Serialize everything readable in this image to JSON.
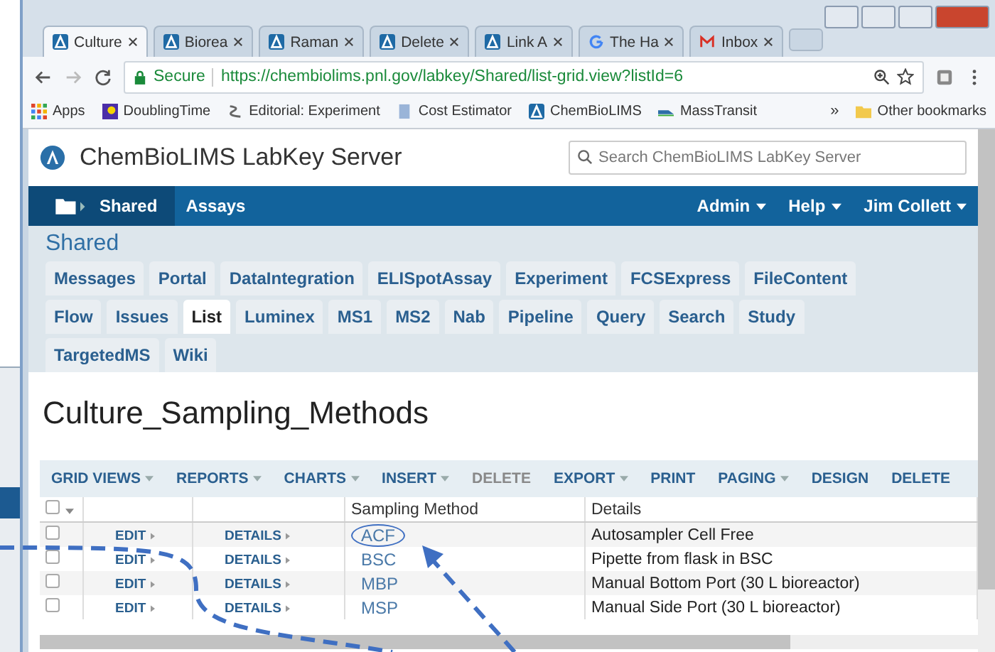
{
  "browser_tabs": [
    {
      "title": "Culture",
      "selected": true,
      "kind": "labkey"
    },
    {
      "title": "Biorea",
      "selected": false,
      "kind": "labkey"
    },
    {
      "title": "Raman",
      "selected": false,
      "kind": "labkey"
    },
    {
      "title": "Delete",
      "selected": false,
      "kind": "labkey"
    },
    {
      "title": "Link A",
      "selected": false,
      "kind": "labkey"
    },
    {
      "title": "The Ha",
      "selected": false,
      "kind": "google"
    },
    {
      "title": "Inbox",
      "selected": false,
      "kind": "mail"
    }
  ],
  "address_bar": {
    "security": "Secure",
    "url": "https://chembiolims.pnl.gov/labkey/Shared/list-grid.view?listId=6"
  },
  "bookmarks": [
    {
      "label": "Apps",
      "kind": "grid"
    },
    {
      "label": "DoublingTime",
      "kind": "square"
    },
    {
      "label": "Editorial: Experiment",
      "kind": "wave"
    },
    {
      "label": "Cost Estimator",
      "kind": "doc"
    },
    {
      "label": "ChemBioLIMS",
      "kind": "labkey"
    },
    {
      "label": "MassTransit",
      "kind": "arrow"
    }
  ],
  "bookmarks_more": "»",
  "other_bookmarks": "Other bookmarks",
  "site": {
    "title": "ChemBioLIMS LabKey Server",
    "search_placeholder": "Search ChemBioLIMS LabKey Server"
  },
  "nav": {
    "folder": "Shared",
    "left": [
      {
        "label": "Assays"
      }
    ],
    "right": [
      {
        "label": "Admin"
      },
      {
        "label": "Help"
      },
      {
        "label": "Jim Collett"
      }
    ]
  },
  "folder_title": "Shared",
  "folder_tabs": [
    {
      "label": "Messages",
      "selected": false
    },
    {
      "label": "Portal",
      "selected": false
    },
    {
      "label": "DataIntegration",
      "selected": false
    },
    {
      "label": "ELISpotAssay",
      "selected": false
    },
    {
      "label": "Experiment",
      "selected": false
    },
    {
      "label": "FCSExpress",
      "selected": false
    },
    {
      "label": "FileContent",
      "selected": false
    },
    {
      "label": "Flow",
      "selected": false
    },
    {
      "label": "Issues",
      "selected": false
    },
    {
      "label": "List",
      "selected": true
    },
    {
      "label": "Luminex",
      "selected": false
    },
    {
      "label": "MS1",
      "selected": false
    },
    {
      "label": "MS2",
      "selected": false
    },
    {
      "label": "Nab",
      "selected": false
    },
    {
      "label": "Pipeline",
      "selected": false
    },
    {
      "label": "Query",
      "selected": false
    },
    {
      "label": "Search",
      "selected": false
    },
    {
      "label": "Study",
      "selected": false
    },
    {
      "label": "TargetedMS",
      "selected": false
    },
    {
      "label": "Wiki",
      "selected": false
    }
  ],
  "list_title": "Culture_Sampling_Methods",
  "grid_toolbar": [
    {
      "label": "GRID VIEWS",
      "menu": true,
      "disabled": false
    },
    {
      "label": "REPORTS",
      "menu": true,
      "disabled": false
    },
    {
      "label": "CHARTS",
      "menu": true,
      "disabled": false
    },
    {
      "label": "INSERT",
      "menu": true,
      "disabled": false
    },
    {
      "label": "DELETE",
      "menu": false,
      "disabled": true
    },
    {
      "label": "EXPORT",
      "menu": true,
      "disabled": false
    },
    {
      "label": "PRINT",
      "menu": false,
      "disabled": false
    },
    {
      "label": "PAGING",
      "menu": true,
      "disabled": false
    },
    {
      "label": "DESIGN",
      "menu": false,
      "disabled": false
    },
    {
      "label": "DELETE",
      "menu": false,
      "disabled": false
    }
  ],
  "table": {
    "select_all_checked": false,
    "columns": [
      "Sampling Method",
      "Details"
    ],
    "rows": [
      {
        "checked": false,
        "edit": "EDIT",
        "details_link": "DETAILS",
        "method": "ACF",
        "details": "Autosampler Cell Free",
        "circled": true
      },
      {
        "checked": false,
        "edit": "EDIT",
        "details_link": "DETAILS",
        "method": "BSC",
        "details": "Pipette from flask in BSC",
        "circled": false
      },
      {
        "checked": false,
        "edit": "EDIT",
        "details_link": "DETAILS",
        "method": "MBP",
        "details": "Manual Bottom Port (30 L bioreactor)",
        "circled": false
      },
      {
        "checked": false,
        "edit": "EDIT",
        "details_link": "DETAILS",
        "method": "MSP",
        "details": "Manual Side Port (30 L bioreactor)",
        "circled": false
      }
    ]
  }
}
